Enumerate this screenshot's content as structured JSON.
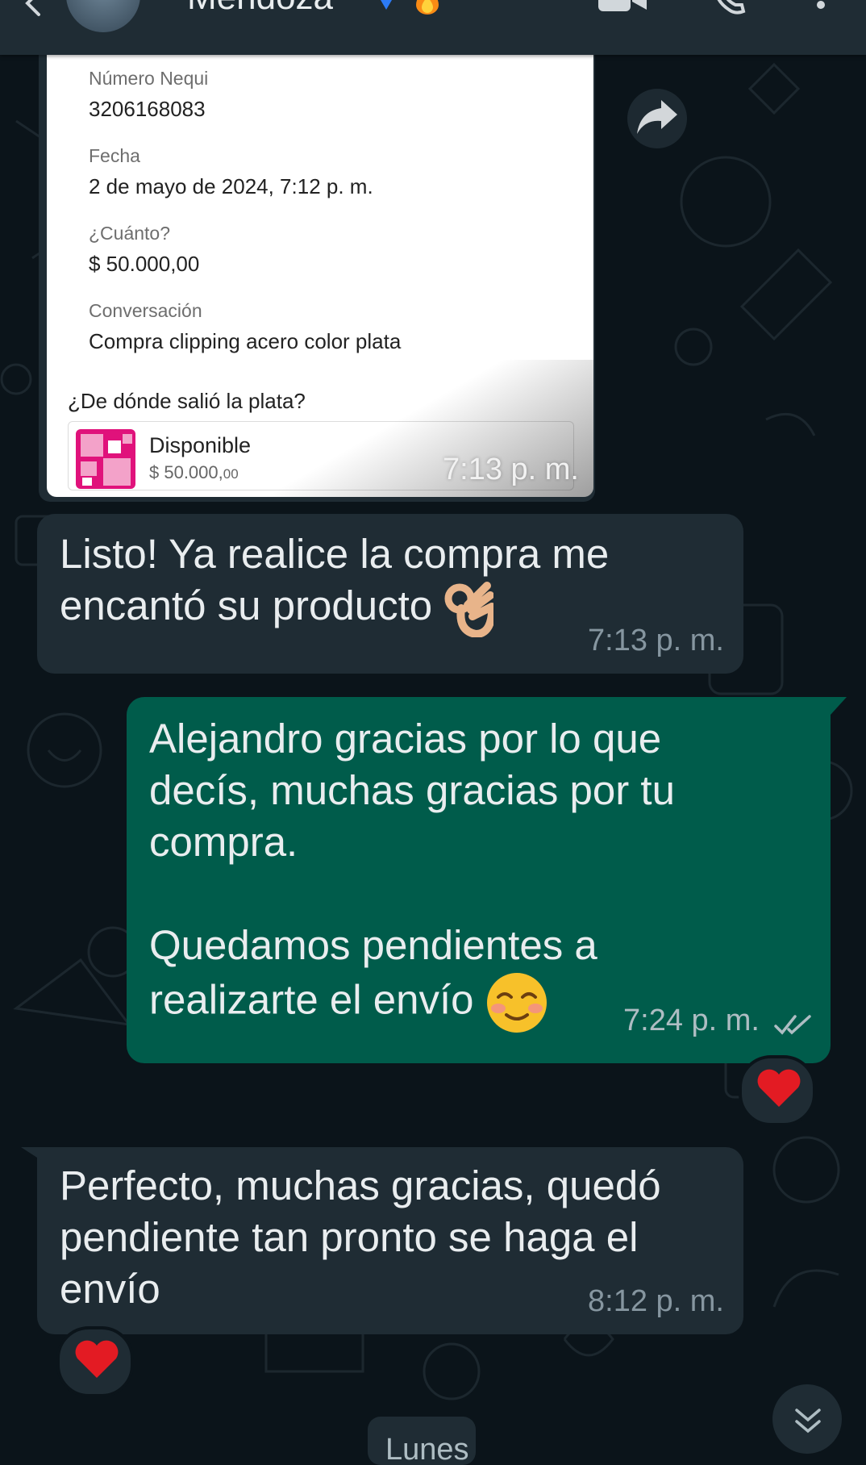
{
  "header": {
    "contact_name": "Mendoza",
    "icons": [
      "back-arrow-icon",
      "verified-badge-icon",
      "fire-emoji-icon",
      "video-call-icon",
      "phone-call-icon",
      "more-vertical-icon"
    ]
  },
  "receipt": {
    "fields": [
      {
        "label": "Número Nequi",
        "value": "3206168083"
      },
      {
        "label": "Fecha",
        "value": "2 de mayo de 2024, 7:12 p. m."
      },
      {
        "label": "¿Cuánto?",
        "value": "$ 50.000,00"
      },
      {
        "label": "Conversación",
        "value": "Compra clipping acero color plata"
      }
    ],
    "source_question": "¿De dónde salió la plata?",
    "account_name": "Disponible",
    "account_amount_main": "$ 50.000,",
    "account_amount_cents": "00",
    "time": "7:13 p. m.",
    "brand_color": "#e0127b"
  },
  "messages": [
    {
      "direction": "incoming",
      "text": "Listo! Ya realice la compra me\nencantó su producto",
      "emoji": "ok-hand-emoji",
      "time": "7:13 p. m."
    },
    {
      "direction": "outgoing",
      "text": "Alejandro gracias por lo que\ndecís, muchas gracias por tu\ncompra.\n\nQuedamos pendientes a\nrealizarte el envío",
      "emoji": "smiling-face-emoji",
      "time": "7:24 p. m.",
      "status": "read-double-check",
      "reaction": "heart-emoji"
    },
    {
      "direction": "incoming",
      "text": "Perfecto, muchas gracias, quedó\npendiente tan pronto se haga el\nenvío",
      "time": "8:12 p. m.",
      "reaction": "heart-emoji"
    }
  ],
  "date_chip": "Lunes",
  "colors": {
    "background": "#0b141a",
    "incoming_bubble": "#1f2c34",
    "outgoing_bubble": "#005c4b",
    "timestamp": "#8696a0",
    "read_check": "#aebdc3"
  }
}
